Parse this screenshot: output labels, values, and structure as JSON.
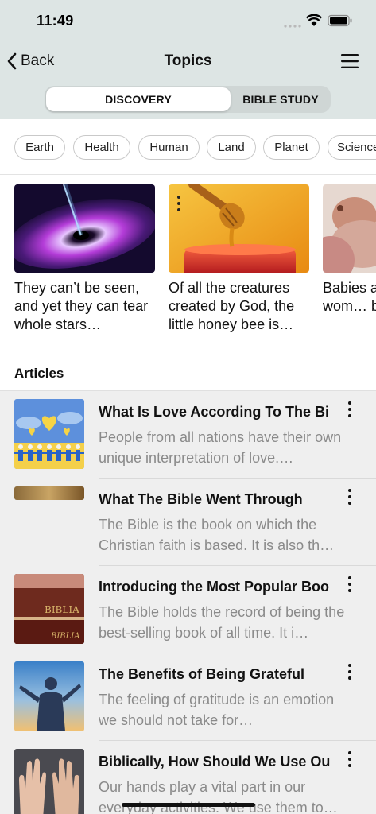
{
  "status_bar": {
    "time": "11:49"
  },
  "header": {
    "back_label": "Back",
    "title": "Topics"
  },
  "segments": [
    {
      "label": "DISCOVERY",
      "selected": true
    },
    {
      "label": "BIBLE STUDY",
      "selected": false
    }
  ],
  "topics": [
    "Earth",
    "Health",
    "Human",
    "Land",
    "Planet",
    "Science"
  ],
  "cards": [
    {
      "text": "They can’t be seen, and yet they can tear whole stars…",
      "image": "black-hole"
    },
    {
      "text": "Of all the creatures created by God, the little honey bee is…",
      "image": "honey-dipper"
    },
    {
      "text": "Babies a… and wom… beings.",
      "image": "mother-and-baby"
    }
  ],
  "section": {
    "articles_label": "Articles"
  },
  "articles": [
    {
      "title": "What Is Love According To The Bi",
      "desc": "People from all nations have their own unique interpretation of love.…",
      "image": "hearts-people-illustration"
    },
    {
      "title": "What The Bible Went Through",
      "desc": "The Bible is the book on which the Christian faith is based. It is also th…",
      "image": "old-parchment"
    },
    {
      "title": "Introducing the Most Popular Boo",
      "desc": "The Bible holds the record of being the best-selling book of all time. It i…",
      "image": "bible-books",
      "thumb_text": [
        "BIBLIA",
        "BIBLIA"
      ]
    },
    {
      "title": "The Benefits of Being Grateful",
      "desc": "The feeling of gratitude is an emotion we should not take for…",
      "image": "man-arms-raised-sunset"
    },
    {
      "title": "Biblically, How Should We Use Ou",
      "desc": "Our hands play a vital part in our everyday activities. We use them to…",
      "image": "raised-hands"
    }
  ]
}
